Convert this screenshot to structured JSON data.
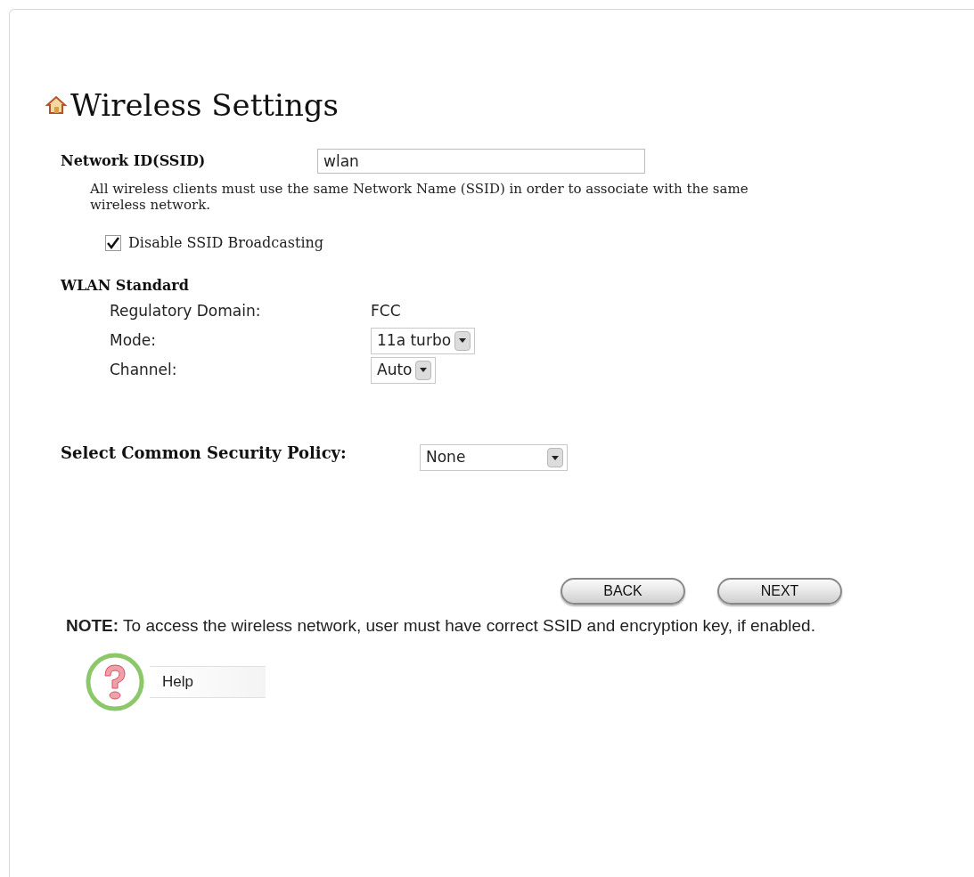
{
  "title": "Wireless Settings",
  "ssid": {
    "label": "Network ID(SSID)",
    "value": "wlan",
    "description": "All wireless clients must use the same Network Name (SSID) in order to associate with the same wireless network."
  },
  "broadcast": {
    "label": "Disable SSID Broadcasting",
    "checked": true
  },
  "wlan_standard": {
    "heading": "WLAN Standard",
    "rows": [
      {
        "kind": "text",
        "label": "Regulatory Domain:",
        "value": "FCC"
      },
      {
        "kind": "select",
        "label": "Mode:",
        "value": "11a turbo"
      },
      {
        "kind": "select",
        "label": "Channel:",
        "value": "Auto"
      }
    ]
  },
  "security": {
    "label": "Select Common Security Policy:",
    "value": "None"
  },
  "buttons": [
    "BACK",
    "NEXT"
  ],
  "note": "**NOTE:** To access the wireless network, user must have correct SSID and encryption key, if enabled.",
  "help": "Help"
}
